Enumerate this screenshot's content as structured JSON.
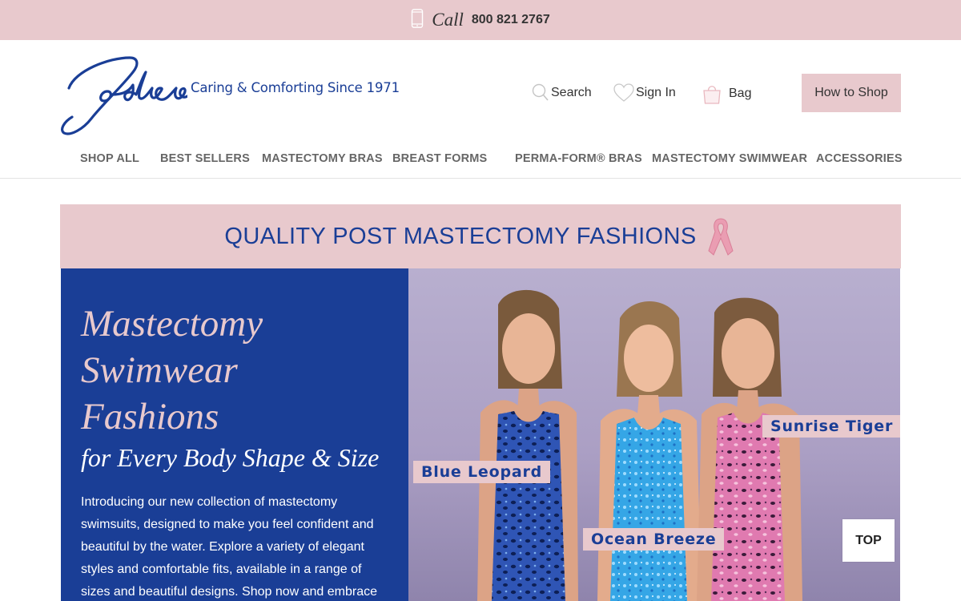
{
  "top_bar": {
    "call_label": "Call",
    "phone_number": "800 821 2767",
    "icon": "mobile-phone-icon"
  },
  "header": {
    "logo_text": "Jodee",
    "tagline": "Caring & Comforting Since 1971",
    "search_label": "Search",
    "signin_label": "Sign In",
    "bag_label": "Bag",
    "how_to_shop_label": "How to Shop",
    "icons": [
      "search-icon",
      "heart-icon",
      "bag-icon"
    ]
  },
  "nav": {
    "items": [
      {
        "label": "SHOP ALL"
      },
      {
        "label": "BEST SELLERS"
      },
      {
        "label": "MASTECTOMY BRAS"
      },
      {
        "label": "BREAST FORMS"
      },
      {
        "label": "PERMA-FORM® BRAS"
      },
      {
        "label": "MASTECTOMY SWIMWEAR"
      },
      {
        "label": "ACCESSORIES"
      }
    ]
  },
  "promo": {
    "text": "QUALITY POST MASTECTOMY FASHIONS",
    "icon": "pink-ribbon-icon"
  },
  "hero": {
    "title_line1": "Mastectomy",
    "title_line2": "Swimwear",
    "title_line3": "Fashions",
    "subtitle": "for Every Body Shape & Size",
    "body": "Introducing our new collection of mastectomy swimsuits, designed to make you feel confident and beautiful by the water. Explore a variety of elegant styles and comfortable fits, available in a range of sizes and beautiful designs. Shop now and embrace",
    "product_tags": [
      "Blue Leopard",
      "Ocean Breeze",
      "Sunrise Tiger"
    ]
  },
  "back_to_top": {
    "label": "TOP"
  },
  "colors": {
    "pink": "#e8c9cd",
    "navy": "#1a3e96",
    "nav_text": "#666666",
    "white": "#ffffff"
  }
}
